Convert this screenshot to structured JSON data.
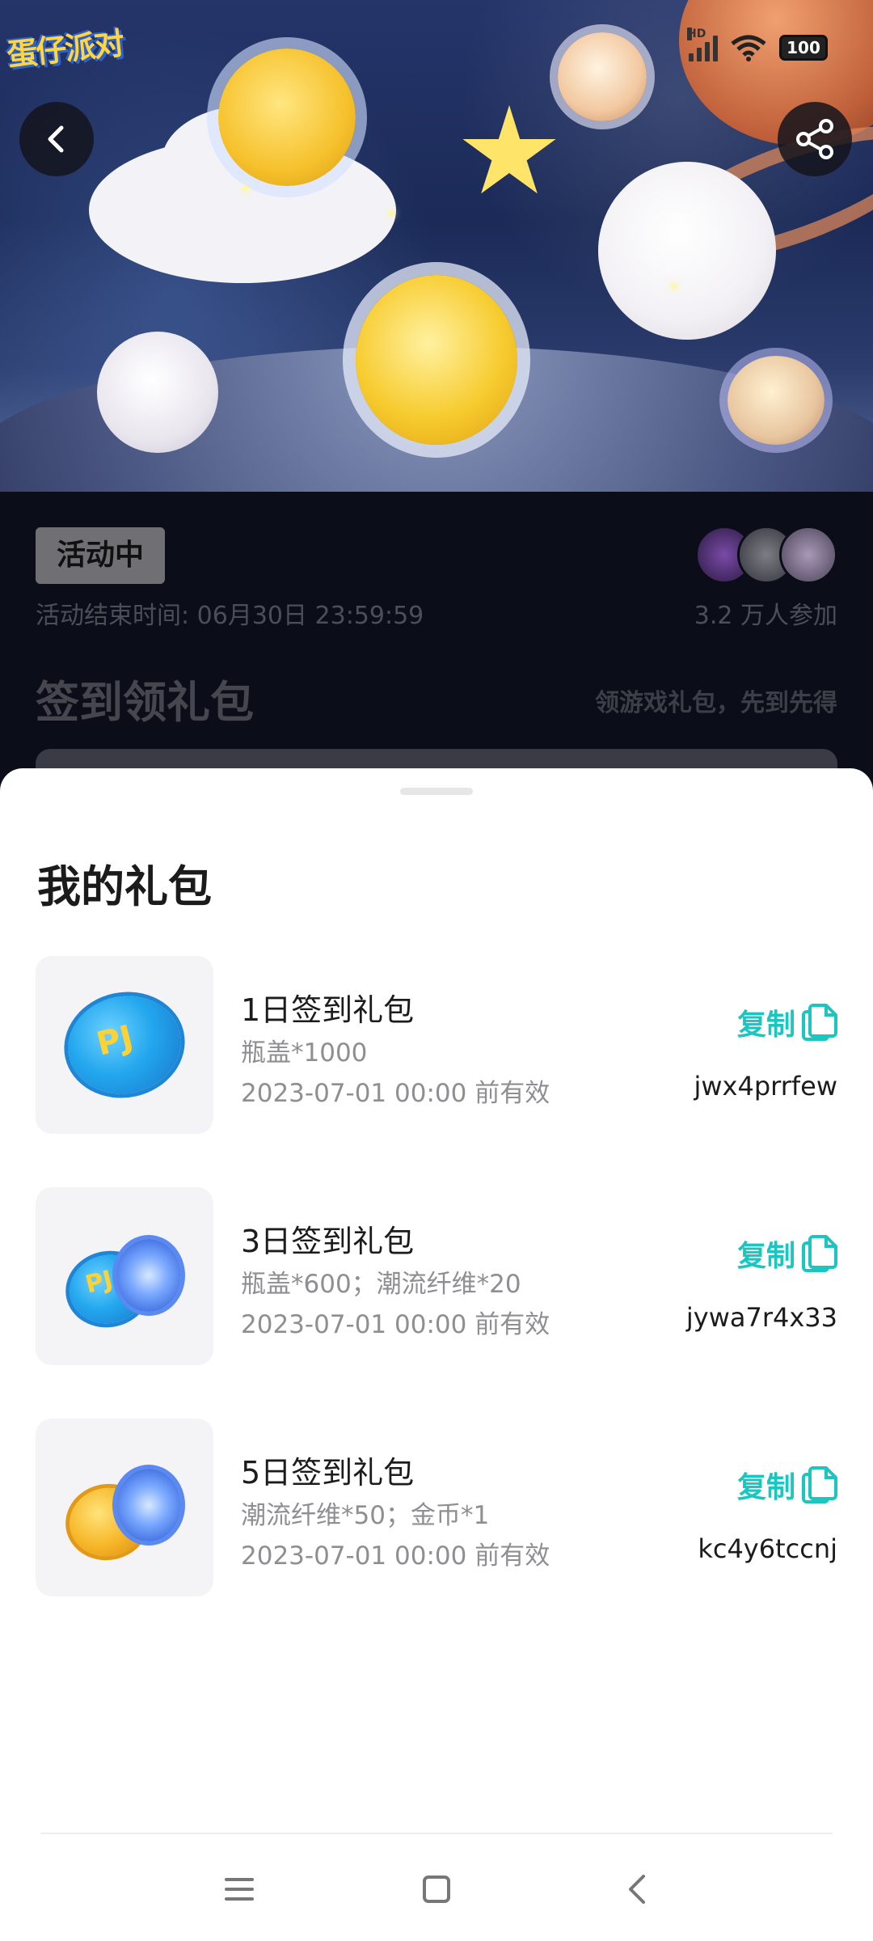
{
  "app": {
    "logo_text": "蛋仔派对"
  },
  "status_bar": {
    "network_badge": "HD",
    "battery": "100"
  },
  "header": {
    "back_icon": "chevron-left-icon",
    "share_icon": "share-icon"
  },
  "activity": {
    "status": "活动中",
    "end_time": "活动结束时间: 06月30日 23:59:59",
    "participants": "3.2 万人参加",
    "section_title": "签到领礼包",
    "section_subtitle": "领游戏礼包，先到先得"
  },
  "sheet": {
    "title": "我的礼包",
    "copy_label": "复制",
    "gifts": [
      {
        "name": "1日签到礼包",
        "content": "瓶盖*1000",
        "expiry": "2023-07-01 00:00 前有效",
        "code": "jwx4prrfew"
      },
      {
        "name": "3日签到礼包",
        "content": "瓶盖*600；潮流纤维*20",
        "expiry": "2023-07-01 00:00 前有效",
        "code": "jywa7r4x33"
      },
      {
        "name": "5日签到礼包",
        "content": "潮流纤维*50；金币*1",
        "expiry": "2023-07-01 00:00 前有效",
        "code": "kc4y6tccnj"
      }
    ]
  },
  "colors": {
    "accent": "#1cc6c0",
    "sheet_bg": "#ffffff",
    "dark_bg": "#0b0d18"
  }
}
